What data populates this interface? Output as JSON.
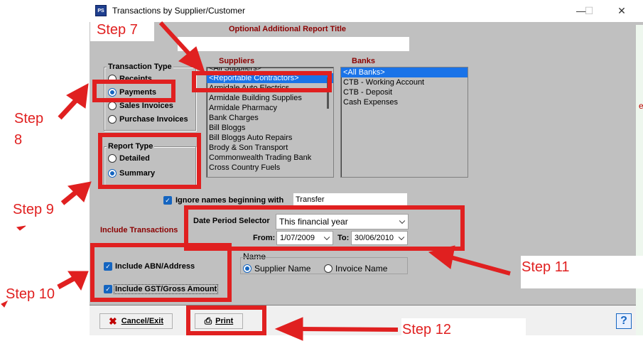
{
  "window": {
    "title": "Transactions by Supplier/Customer",
    "icon_text": "PS",
    "minimize": "—",
    "maximize": "☐",
    "close": "✕"
  },
  "report_title_label": "Optional Additional Report Title",
  "report_title_value": "",
  "transaction_type": {
    "label": "Transaction Type",
    "options": [
      "Receipts",
      "Payments",
      "Sales Invoices",
      "Purchase Invoices"
    ],
    "selected": "Payments"
  },
  "report_type": {
    "label": "Report Type",
    "options": [
      "Detailed",
      "Summary"
    ],
    "selected": "Summary"
  },
  "suppliers": {
    "label": "Suppliers",
    "items": [
      "<All Suppliers>",
      "<Reportable Contractors>",
      "Armidale Auto Electrics",
      "Armidale Building Supplies",
      "Armidale Pharmacy",
      "Bank Charges",
      "Bill Bloggs",
      "Bill Bloggs Auto Repairs",
      "Brody & Son Transport",
      "Commonwealth Trading Bank",
      "Cross Country Fuels"
    ],
    "selected": "<Reportable Contractors>"
  },
  "banks": {
    "label": "Banks",
    "items": [
      "<All Banks>",
      "CTB - Working Account",
      "CTB - Deposit",
      "Cash Expenses"
    ],
    "selected": "<All Banks>"
  },
  "ignore_names": {
    "label": "Ignore names beginning with",
    "value": "Transfer",
    "checked": true
  },
  "date_period": {
    "label": "Date Period Selector",
    "value": "This financial year",
    "from_label": "From:",
    "from_value": "1/07/2009",
    "to_label": "To:",
    "to_value": "30/06/2010"
  },
  "include_transactions_label": "Include Transactions",
  "include_abn": {
    "label": "Include ABN/Address",
    "checked": true
  },
  "include_gst": {
    "label": "Include GST/Gross Amount",
    "checked": true
  },
  "name_group": {
    "label": "Name",
    "options": [
      "Supplier Name",
      "Invoice Name"
    ],
    "selected": "Supplier Name"
  },
  "buttons": {
    "cancel": "Cancel/Exit",
    "print": "Print",
    "help": "?"
  },
  "annotations": {
    "step7": "Step 7",
    "step8a": "Step",
    "step8b": "8",
    "step9": "Step 9",
    "step10": "Step 10",
    "step11": "Step 11",
    "step12": "Step 12"
  },
  "colors": {
    "annotation_red": "#e02020",
    "selection_blue": "#1a73e8",
    "window_gray": "#c0c0c0"
  }
}
